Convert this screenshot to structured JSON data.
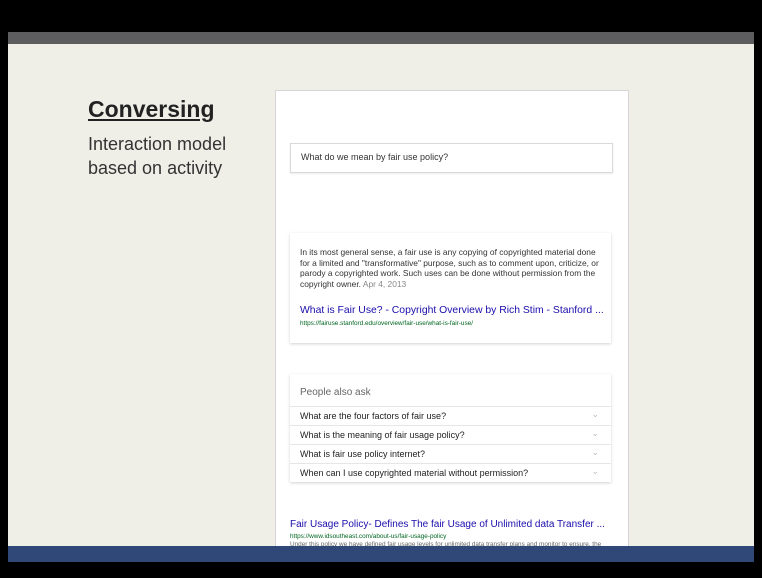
{
  "slide": {
    "title": "Conversing",
    "subtitle": "Interaction model based on activity"
  },
  "search": {
    "query": "What do we mean by fair use policy?"
  },
  "snippet": {
    "text": "In its most general sense, a fair use is any copying of copyrighted material done for a limited and \"transformative\" purpose, such as to comment upon, criticize, or parody a copyrighted work. Such uses can be done without permission from the copyright owner.",
    "date": "Apr 4, 2013",
    "link_title": "What is Fair Use? - Copyright Overview by Rich Stim - Stanford ...",
    "link_url": "https://fairuse.stanford.edu/overview/fair-use/what-is-fair-use/"
  },
  "people_also_ask": {
    "title": "People also ask",
    "questions": [
      "What are the four factors of fair use?",
      "What is the meaning of fair usage policy?",
      "What is fair use policy internet?",
      "When can I use copyrighted material without permission?"
    ],
    "chevron_icon": "chevron-down-icon"
  },
  "result": {
    "title": "Fair Usage Policy- Defines The fair Usage of Unlimited data Transfer ...",
    "url": "https://www.idsoutheast.com/about-us/fair-usage-policy",
    "description": "Under this policy we have defined fair usage levels for unlimited data transfer plans and monitor to ensure, the usage levels are not above normal usage such ..."
  },
  "colors": {
    "slide_bg": "#efefe8",
    "bottom_bar": "#2f4878",
    "link": "#1a0dab",
    "url": "#006621"
  }
}
